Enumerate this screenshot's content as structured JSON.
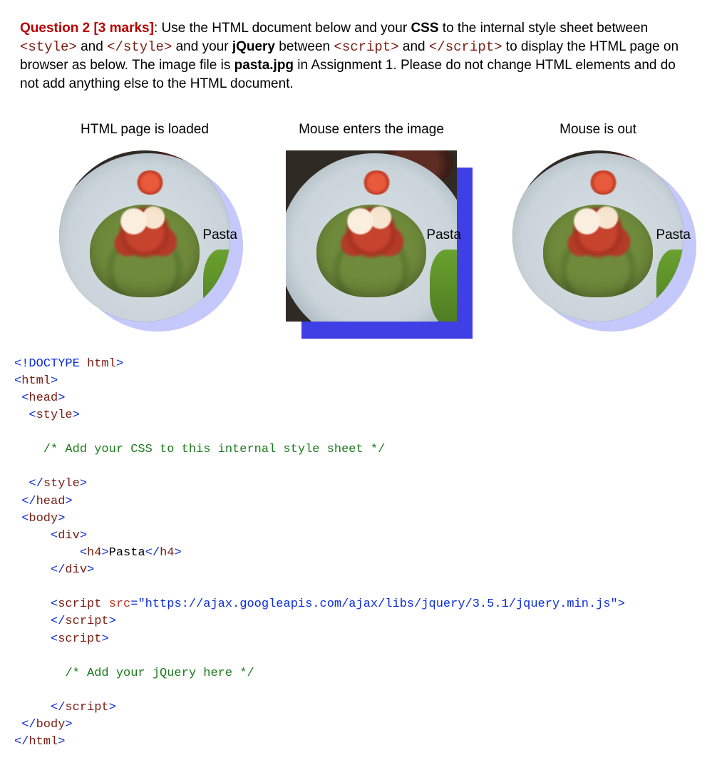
{
  "question": {
    "label": "Question 2 [3 marks]",
    "body_1": ": Use the HTML document below and your ",
    "css_bold": "CSS",
    "body_2": " to the internal style sheet between ",
    "inline_1": "<style>",
    "body_3": " and ",
    "inline_2": "</style>",
    "body_4": " and your ",
    "jq_bold": "jQuery",
    "body_5": " between ",
    "inline_3": "<script>",
    "body_6": " and ",
    "inline_4": "</script>",
    "body_7": " to display the HTML page on browser as below. The image file is ",
    "pasta_bold": "pasta.jpg",
    "body_8": " in Assignment 1. Please do not change HTML elements and do not add anything else to the HTML document."
  },
  "states": {
    "loaded": "HTML page is loaded",
    "hover": "Mouse enters the image",
    "out": "Mouse is out",
    "label": "Pasta"
  },
  "code": {
    "l01a": "<!",
    "l01b": "DOCTYPE ",
    "l01c": "html",
    "l01d": ">",
    "l02a": "<",
    "l02b": "html",
    "l02c": ">",
    "l03a": " <",
    "l03b": "head",
    "l03c": ">",
    "l04a": "  <",
    "l04b": "style",
    "l04c": ">",
    "l05": "",
    "l06": "    /* Add your CSS to this internal style sheet */",
    "l07": "",
    "l08a": "  </",
    "l08b": "style",
    "l08c": ">",
    "l09a": " </",
    "l09b": "head",
    "l09c": ">",
    "l10a": " <",
    "l10b": "body",
    "l10c": ">",
    "l11a": "     <",
    "l11b": "div",
    "l11c": ">",
    "l12a": "         <",
    "l12b": "h4",
    "l12c": ">",
    "l12d": "Pasta",
    "l12e": "</",
    "l12f": "h4",
    "l12g": ">",
    "l13a": "     </",
    "l13b": "div",
    "l13c": ">",
    "l14": "",
    "l15a": "     <",
    "l15b": "script ",
    "l15c": "src",
    "l15d": "=",
    "l15e": "\"https://ajax.googleapis.com/ajax/libs/jquery/3.5.1/jquery.min.js\"",
    "l15f": ">",
    "l16a": "     </",
    "l16b": "script",
    "l16c": ">",
    "l17a": "     <",
    "l17b": "script",
    "l17c": ">",
    "l18": "",
    "l19": "       /* Add your jQuery here */",
    "l20": "",
    "l21a": "     </",
    "l21b": "script",
    "l21c": ">",
    "l22a": " </",
    "l22b": "body",
    "l22c": ">",
    "l23a": "</",
    "l23b": "html",
    "l23c": ">"
  }
}
